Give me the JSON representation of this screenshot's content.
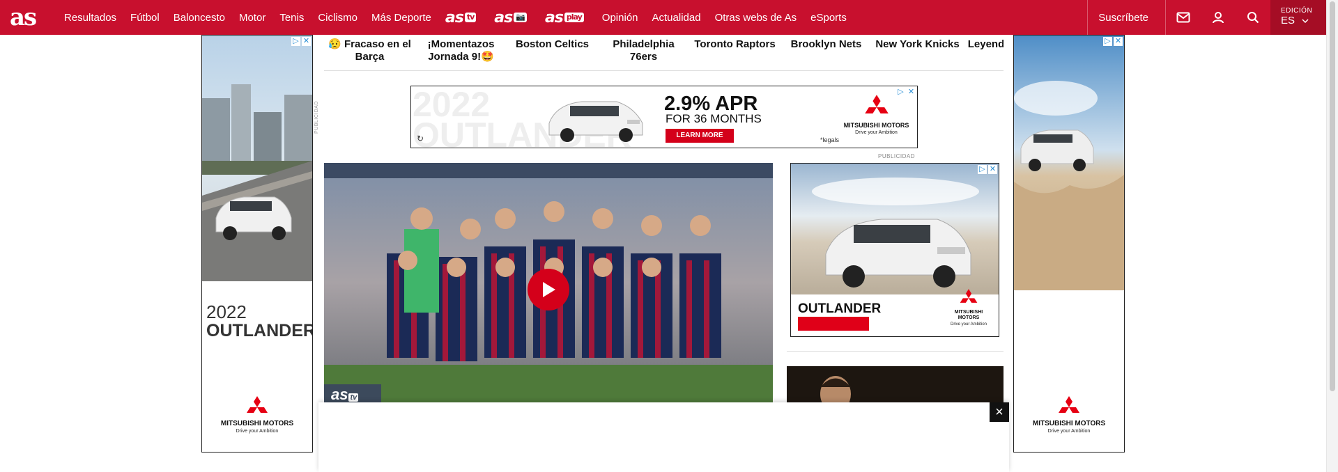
{
  "site": {
    "logo": "as"
  },
  "nav": {
    "items": [
      "Resultados",
      "Fútbol",
      "Baloncesto",
      "Motor",
      "Tenis",
      "Ciclismo",
      "Más Deporte"
    ],
    "brands": [
      {
        "text": "as",
        "suffix": "tv"
      },
      {
        "text": "as",
        "suffix": "📷"
      },
      {
        "text": "as",
        "suffix": "play"
      }
    ],
    "items2": [
      "Opinión",
      "Actualidad",
      "Otras webs de As",
      "eSports"
    ],
    "subscribe": "Suscríbete",
    "icons": [
      "mail-icon",
      "user-icon",
      "search-icon"
    ],
    "edition_label": "EDICIÓN",
    "edition_value": "ES"
  },
  "topics": [
    "😥 Fracaso en el Barça",
    "¡Momentazos Jornada 9!🤩",
    "Boston Celtics",
    "Philadelphia 76ers",
    "Toronto Raptors",
    "Brooklyn Nets",
    "New York Knicks",
    "Leyend mate a L"
  ],
  "ads": {
    "publicidad": "PUBLICIDAD",
    "banner": {
      "ghost": "2022 OUTLANDER",
      "apr": "2.9% APR",
      "months": "FOR 36 MONTHS",
      "cta": "LEARN MORE",
      "legals": "*legals",
      "brand": "MITSUBISHI MOTORS",
      "tagline": "Drive your Ambition"
    },
    "left": {
      "year": "2022",
      "model": "OUTLANDER",
      "brand": "MITSUBISHI MOTORS",
      "tagline": "Drive your Ambition"
    },
    "right": {
      "brand": "MITSUBISHI MOTORS",
      "tagline": "Drive your Ambition"
    },
    "mpu": {
      "model": "OUTLANDER",
      "brand": "MITSUBISHI MOTORS",
      "tagline": "Drive your Ambition"
    }
  },
  "video": {
    "badge": "as",
    "badge_suffix": "tv"
  },
  "colors": {
    "brand_red": "#c8102e",
    "ad_red": "#d4001a"
  }
}
